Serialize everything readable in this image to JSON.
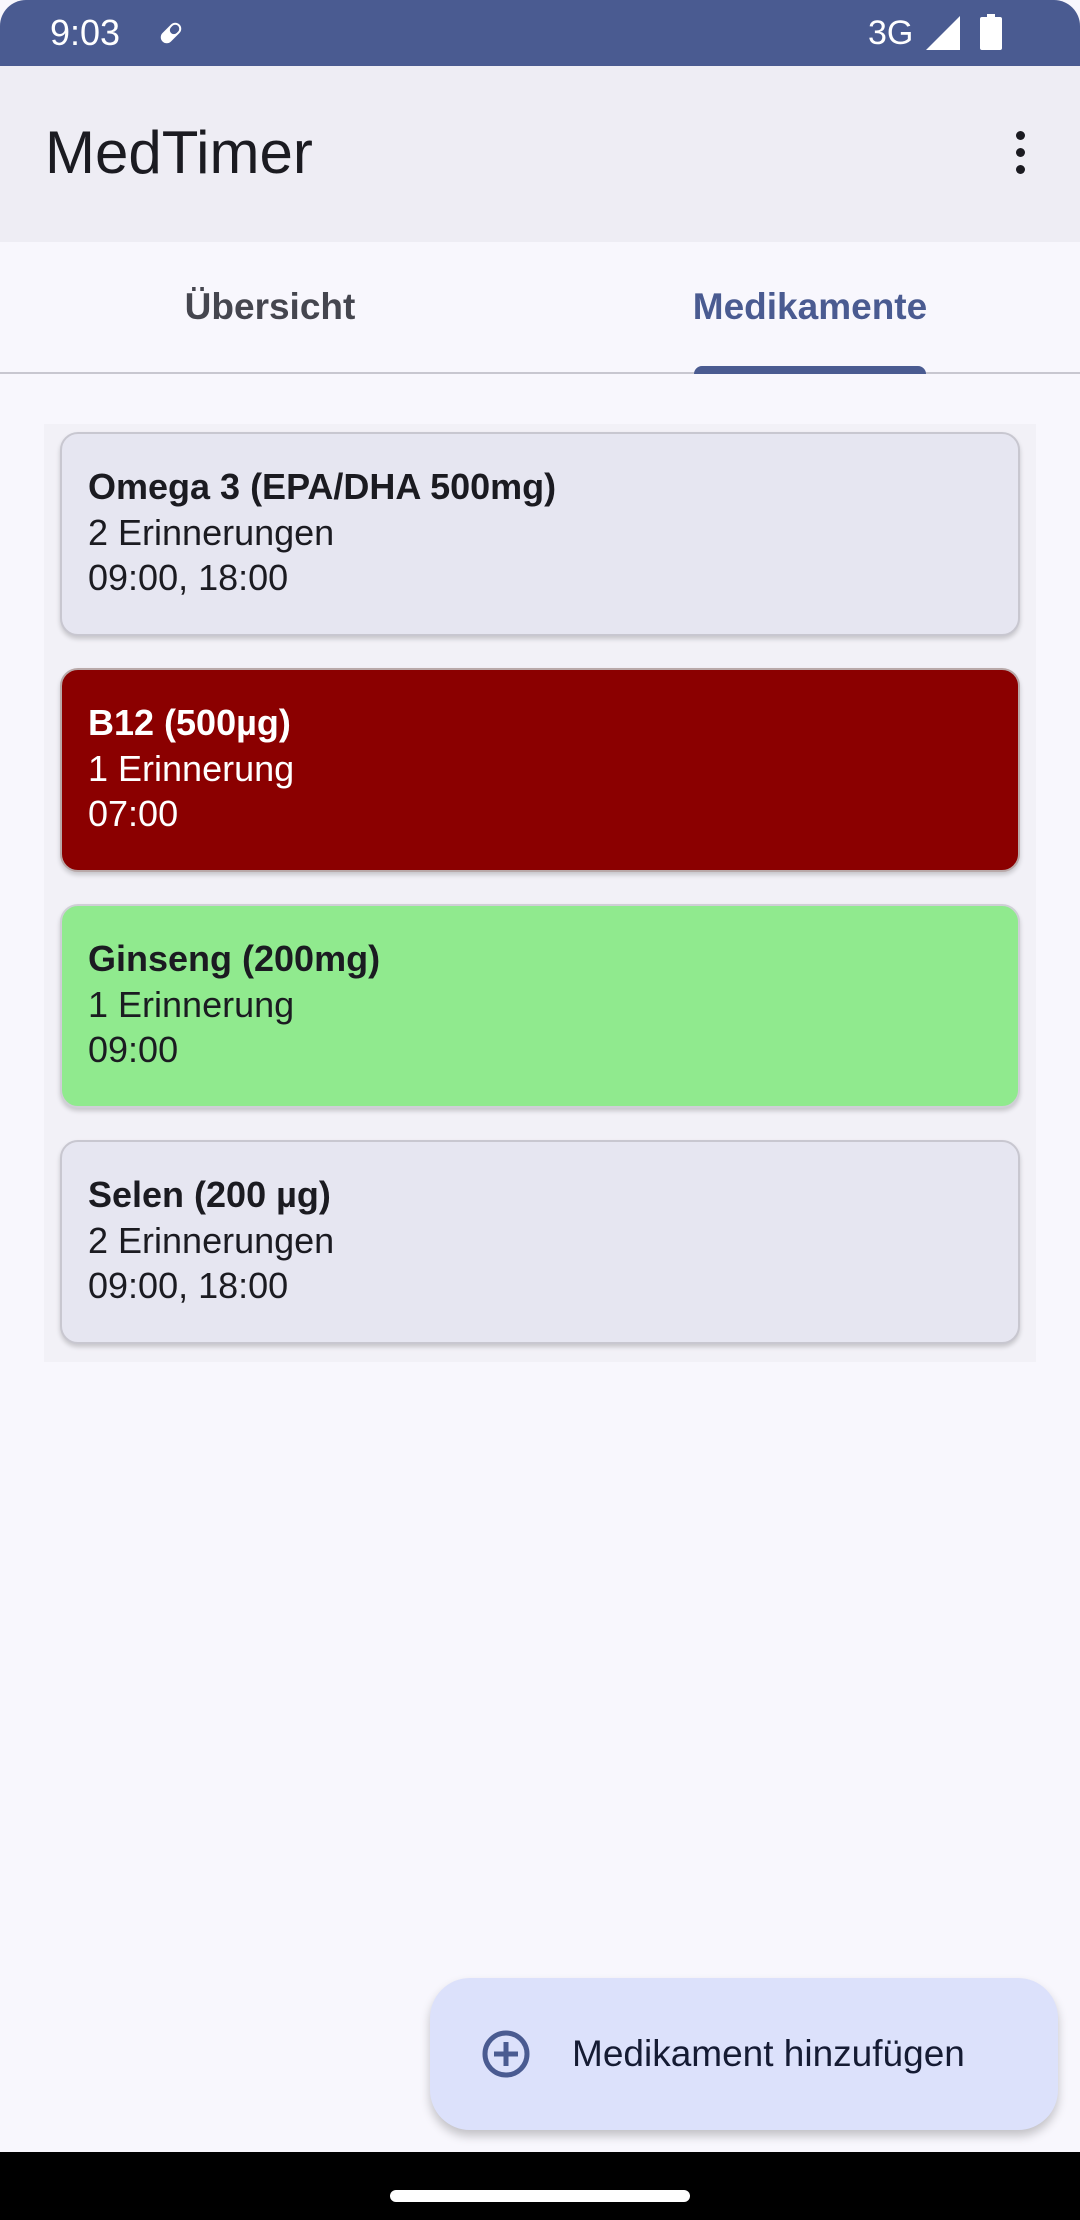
{
  "status_bar": {
    "time": "9:03",
    "network": "3G",
    "icons": [
      "pill-icon",
      "signal-icon",
      "battery-icon"
    ]
  },
  "app_bar": {
    "title": "MedTimer",
    "menu_icon": "more-vert-icon"
  },
  "tabs": [
    {
      "label": "Übersicht",
      "selected": false
    },
    {
      "label": "Medikamente",
      "selected": true
    }
  ],
  "medicines": [
    {
      "name": "Omega 3 (EPA/DHA 500mg)",
      "reminders": "2 Erinnerungen",
      "times": "09:00, 18:00",
      "color": "#e6e6f1"
    },
    {
      "name": "B12 (500µg)",
      "reminders": "1 Erinnerung",
      "times": "07:00",
      "color": "#8b0000"
    },
    {
      "name": "Ginseng (200mg)",
      "reminders": "1 Erinnerung",
      "times": "09:00",
      "color": "#90ea8e"
    },
    {
      "name": "Selen (200 µg)",
      "reminders": "2 Erinnerungen",
      "times": "09:00, 18:00",
      "color": "#e6e6f1"
    }
  ],
  "fab": {
    "label": "Medikament hinzufügen",
    "icon": "add-circle-icon"
  },
  "colors": {
    "status_bar": "#4a5b91",
    "accent": "#4a5b91",
    "fab_bg": "#dce1fb"
  }
}
